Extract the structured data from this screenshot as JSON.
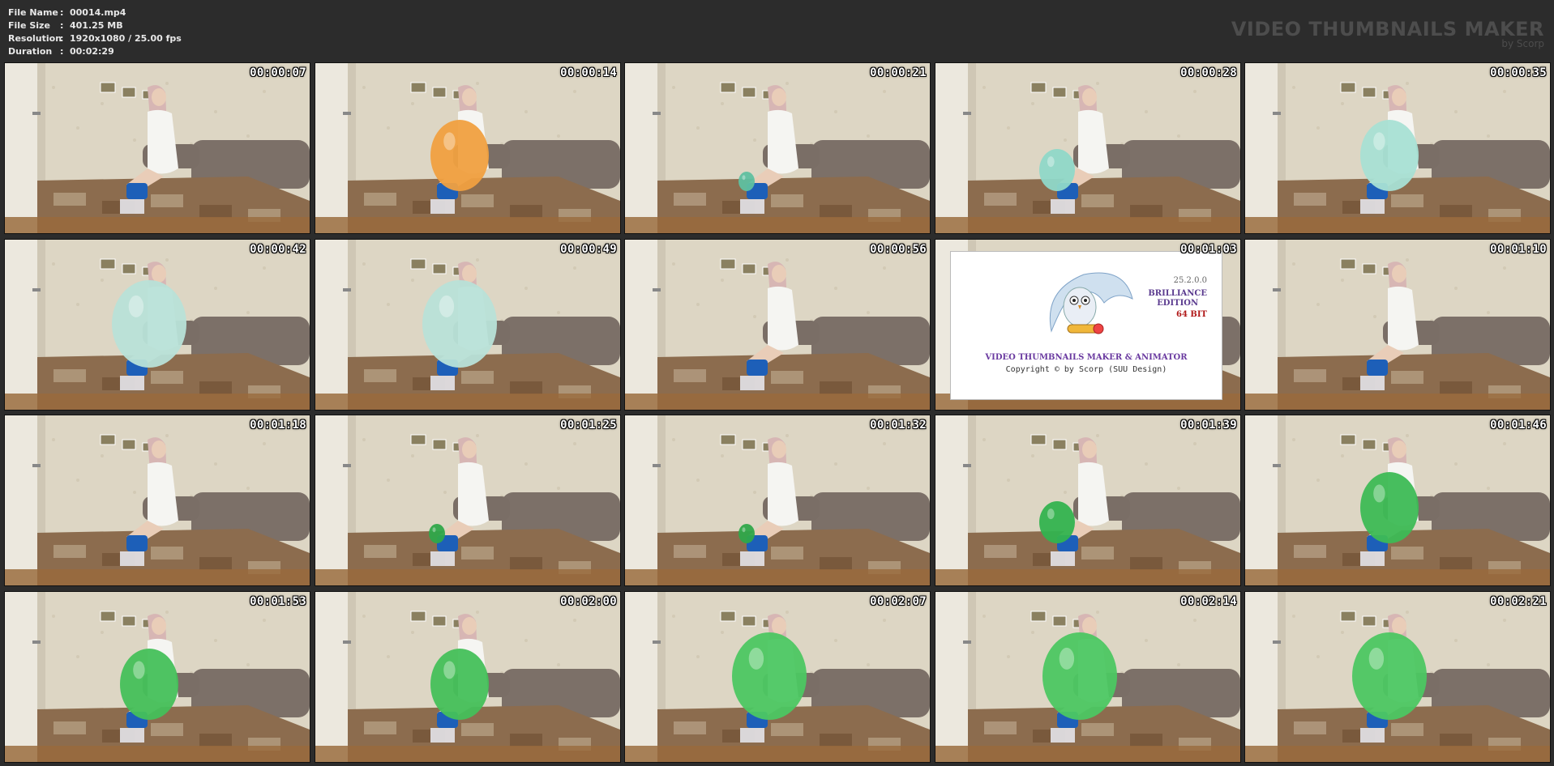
{
  "file_info": {
    "rows": [
      {
        "label": "File Name",
        "sep": ":",
        "value": "00014.mp4"
      },
      {
        "label": "File Size",
        "sep": ":",
        "value": "401.25 MB"
      },
      {
        "label": "Resolution",
        "sep": ":",
        "value": "1920x1080 / 25.00 fps"
      },
      {
        "label": "Duration",
        "sep": ":",
        "value": "00:02:29"
      }
    ]
  },
  "brand": {
    "title": "VIDEO THUMBNAILS MAKER",
    "subtitle": "by Scorp"
  },
  "thumbnails": [
    {
      "timestamp": "00:00:07",
      "balloon": {
        "color": "",
        "size": 0
      },
      "splash": false
    },
    {
      "timestamp": "00:00:14",
      "balloon": {
        "color": "#f0a040",
        "size": 2
      },
      "splash": false
    },
    {
      "timestamp": "00:00:21",
      "balloon": {
        "color": "#5fc0a0",
        "size": 0
      },
      "splash": false
    },
    {
      "timestamp": "00:00:28",
      "balloon": {
        "color": "#8fd8c8",
        "size": 1
      },
      "splash": false
    },
    {
      "timestamp": "00:00:35",
      "balloon": {
        "color": "#a8e0d4",
        "size": 2
      },
      "splash": false
    },
    {
      "timestamp": "00:00:42",
      "balloon": {
        "color": "#b8e2d8",
        "size": 3
      },
      "splash": false
    },
    {
      "timestamp": "00:00:49",
      "balloon": {
        "color": "#b8e2d8",
        "size": 3
      },
      "splash": false
    },
    {
      "timestamp": "00:00:56",
      "balloon": {
        "color": "",
        "size": 0
      },
      "splash": false
    },
    {
      "timestamp": "00:01:03",
      "balloon": {
        "color": "",
        "size": 0
      },
      "splash": true
    },
    {
      "timestamp": "00:01:10",
      "balloon": {
        "color": "",
        "size": 0
      },
      "splash": false
    },
    {
      "timestamp": "00:01:18",
      "balloon": {
        "color": "",
        "size": 0
      },
      "splash": false
    },
    {
      "timestamp": "00:01:25",
      "balloon": {
        "color": "#2fa84a",
        "size": 0
      },
      "splash": false
    },
    {
      "timestamp": "00:01:32",
      "balloon": {
        "color": "#2fa84a",
        "size": 0
      },
      "splash": false
    },
    {
      "timestamp": "00:01:39",
      "balloon": {
        "color": "#33b34f",
        "size": 1
      },
      "splash": false
    },
    {
      "timestamp": "00:01:46",
      "balloon": {
        "color": "#3dbb55",
        "size": 2
      },
      "splash": false
    },
    {
      "timestamp": "00:01:53",
      "balloon": {
        "color": "#44c05a",
        "size": 2
      },
      "splash": false
    },
    {
      "timestamp": "00:02:00",
      "balloon": {
        "color": "#44c05a",
        "size": 2
      },
      "splash": false
    },
    {
      "timestamp": "00:02:07",
      "balloon": {
        "color": "#4cc762",
        "size": 3
      },
      "splash": false
    },
    {
      "timestamp": "00:02:14",
      "balloon": {
        "color": "#4cc762",
        "size": 3
      },
      "splash": false
    },
    {
      "timestamp": "00:02:21",
      "balloon": {
        "color": "#4cc762",
        "size": 3
      },
      "splash": false
    }
  ],
  "splash": {
    "version": "25.2.0.0",
    "edition_line1": "BRILLIANCE",
    "edition_line2": "EDITION",
    "bits": "64 BIT",
    "product": "VIDEO THUMBNAILS MAKER & ANIMATOR",
    "copyright": "Copyright © by Scorp (SUU Design)"
  }
}
